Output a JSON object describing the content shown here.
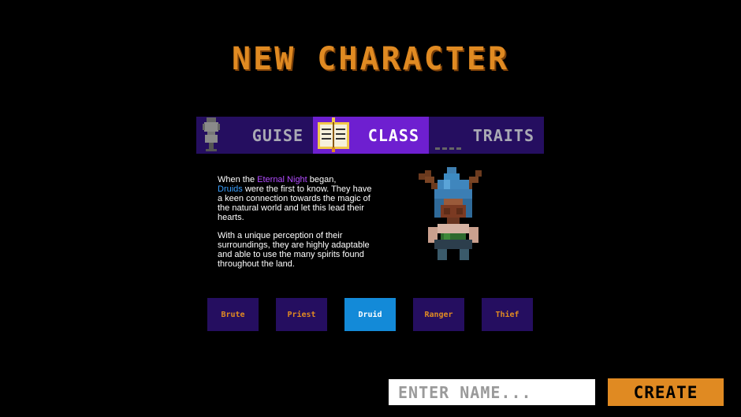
{
  "screen": {
    "title": "NEW CHARACTER"
  },
  "tabs": [
    {
      "id": "guise",
      "label": "GUISE",
      "icon": "mannequin-icon",
      "active": false
    },
    {
      "id": "class",
      "label": "CLASS",
      "icon": "spellbook-icon",
      "active": true
    },
    {
      "id": "traits",
      "label": "TRAITS",
      "icon": "traits-icon",
      "active": false
    }
  ],
  "description": {
    "p1_before": "When the ",
    "p1_highlight1": "Eternal Night",
    "p1_middle": " began, ",
    "p1_highlight2": "Druids",
    "p1_after": " were the first to know. They have a keen connection towards the magic of the natural world and let this lead their hearts.",
    "p2": "With a unique perception of their surroundings, they are highly adaptable and able to use the many spirits found throughout the land."
  },
  "character_preview": {
    "icon": "druid-sprite-icon",
    "class": "Druid"
  },
  "classes": [
    "Brute",
    "Priest",
    "Druid",
    "Ranger",
    "Thief"
  ],
  "selected_class": "Druid",
  "name_input": {
    "value": "",
    "placeholder": "ENTER NAME..."
  },
  "create_button": {
    "label": "CREATE"
  },
  "colors": {
    "accent_orange": "#e08a22",
    "panel_dark_purple": "#250e60",
    "tab_active_purple": "#6e1fd0",
    "selected_blue": "#138ad8",
    "highlight_purple": "#b34cff",
    "highlight_blue": "#3aa0ff"
  }
}
